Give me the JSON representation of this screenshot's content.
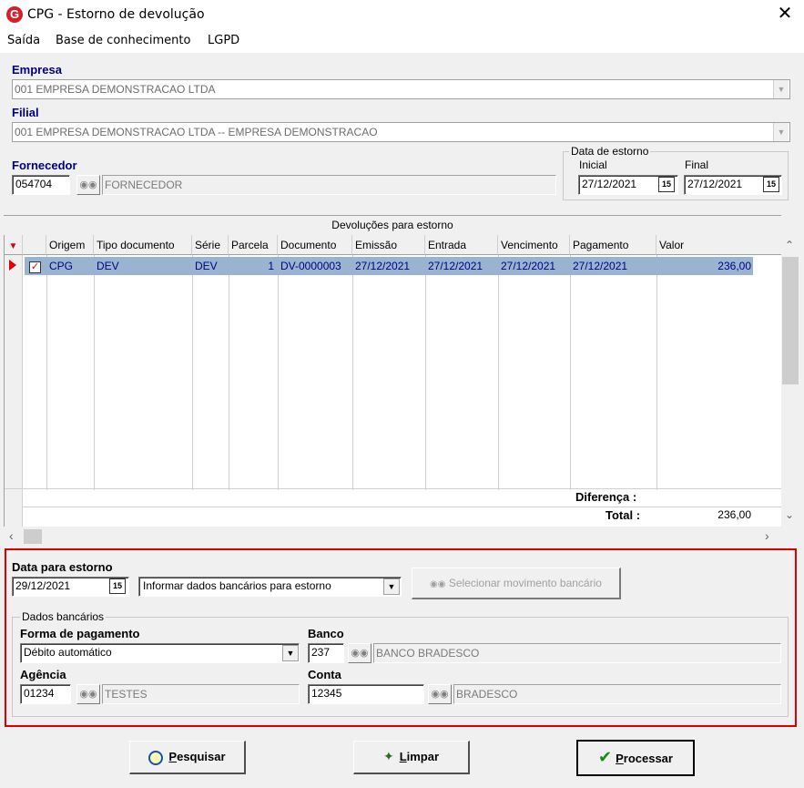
{
  "window": {
    "title": "CPG - Estorno de devolução",
    "close_glyph": "✕",
    "logo": "G"
  },
  "menu": [
    "Saída",
    "Base de conhecimento",
    "LGPD"
  ],
  "empresa": {
    "label": "Empresa",
    "value": "001 EMPRESA DEMONSTRACAO LTDA"
  },
  "filial": {
    "label": "Filial",
    "value": "001 EMPRESA DEMONSTRACAO LTDA -- EMPRESA DEMONSTRACAO"
  },
  "fornecedor": {
    "label": "Fornecedor",
    "code": "054704",
    "name": "FORNECEDOR"
  },
  "data_estorno": {
    "legend": "Data de estorno",
    "inicial_label": "Inicial",
    "inicial": "27/12/2021",
    "final_label": "Final",
    "final": "27/12/2021"
  },
  "grid": {
    "caption": "Devoluções para estorno",
    "columns": [
      "Origem",
      "Tipo documento",
      "Série",
      "Parcela",
      "Documento",
      "Emissão",
      "Entrada",
      "Vencimento",
      "Pagamento",
      "Valor"
    ],
    "rows": [
      {
        "origem": "CPG",
        "tipo": "DEV",
        "serie": "DEV",
        "parcela": "1",
        "documento": "DV-0000003",
        "emissao": "27/12/2021",
        "entrada": "27/12/2021",
        "vencimento": "27/12/2021",
        "pagamento": "27/12/2021",
        "valor": "236,00",
        "checked": true
      }
    ],
    "diferenca_label": "Diferença :",
    "total_label": "Total :",
    "total_value": "236,00"
  },
  "estorno": {
    "data_label": "Data para estorno",
    "data_value": "29/12/2021",
    "modo_value": "Informar dados bancários para estorno",
    "selecionar_label": "Selecionar movimento bancário"
  },
  "dados_bancarios": {
    "legend": "Dados bancários",
    "forma_label": "Forma de pagamento",
    "forma_value": "Débito automático",
    "banco_label": "Banco",
    "banco_code": "237",
    "banco_name": "BANCO BRADESCO",
    "agencia_label": "Agência",
    "agencia_code": "01234",
    "agencia_name": "TESTES",
    "conta_label": "Conta",
    "conta_code": "12345",
    "conta_name": "BRADESCO"
  },
  "buttons": {
    "pesquisar_first": "P",
    "pesquisar_rest": "esquisar",
    "limpar_first": "L",
    "limpar_rest": "impar",
    "processar_first": "P",
    "processar_rest": "rocessar"
  },
  "icons": {
    "binoculars": "binoculars-icon",
    "calendar": "15"
  }
}
